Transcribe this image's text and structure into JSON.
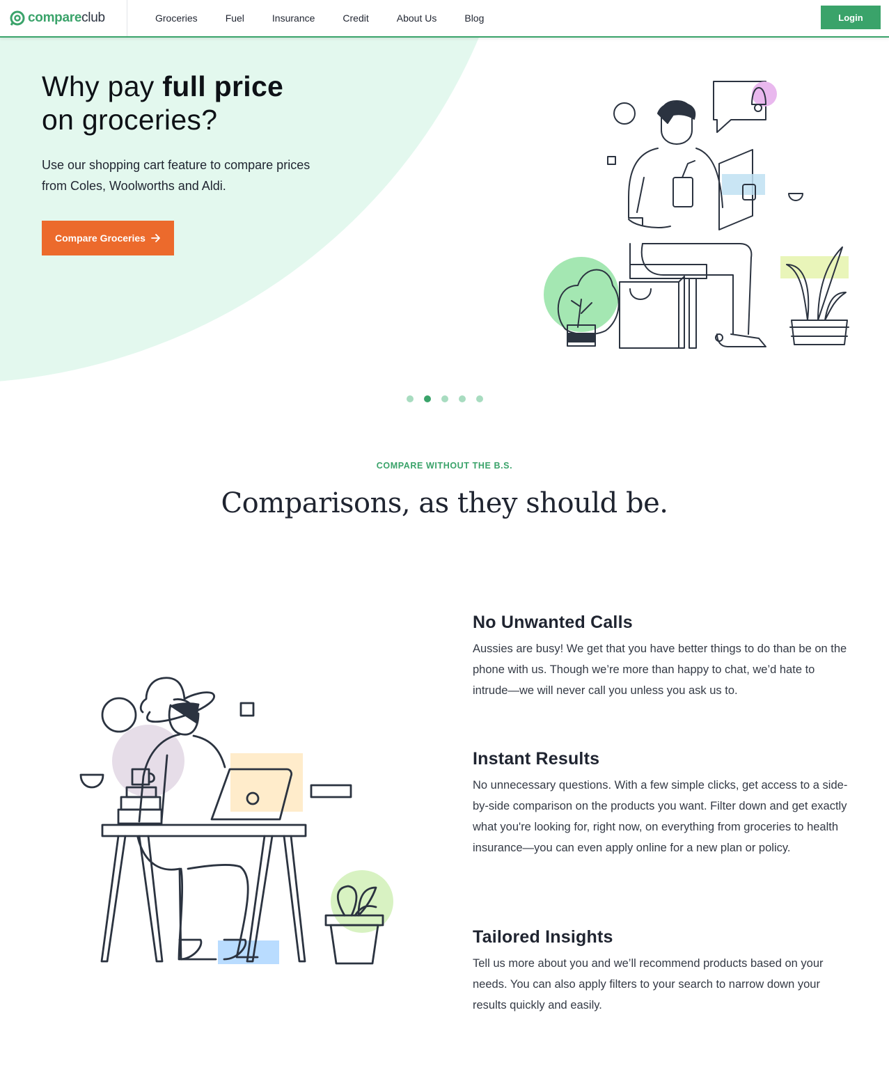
{
  "header": {
    "logo": {
      "part1": "compare",
      "part2": "club"
    },
    "nav": [
      "Groceries",
      "Fuel",
      "Insurance",
      "Credit",
      "About Us",
      "Blog"
    ],
    "login_label": "Login",
    "colors": {
      "brand": "#3aa36a"
    }
  },
  "hero": {
    "title_prefix": "Why pay ",
    "title_bold": "full price",
    "title_line2": "on groceries?",
    "subtitle": "Use our shopping cart feature to compare prices from Coles, Woolworths and Aldi.",
    "cta_label": "Compare Groceries",
    "cta_color": "#ec6a2c",
    "carousel": {
      "total": 5,
      "active_index": 1
    }
  },
  "section": {
    "eyebrow": "COMPARE WITHOUT THE B.S.",
    "title": "Comparisons, as they should be."
  },
  "features": [
    {
      "title": "No Unwanted Calls",
      "body": "Aussies are busy! We get that you have better things to do than be on the phone with us. Though we’re more than happy to chat, we’d hate to intrude—we will never call you unless you ask us to."
    },
    {
      "title": "Instant Results",
      "body": "No unnecessary questions. With a few simple clicks, get access to a side-by-side comparison on the products you want. Filter down and get exactly what you're looking for, right now, on everything from groceries to health insurance—you can even apply online for a new plan or policy."
    },
    {
      "title": "Tailored Insights",
      "body": "Tell us more about you and we’ll recommend products based on your needs. You can also apply filters to your search to narrow down your results quickly and easily."
    }
  ]
}
